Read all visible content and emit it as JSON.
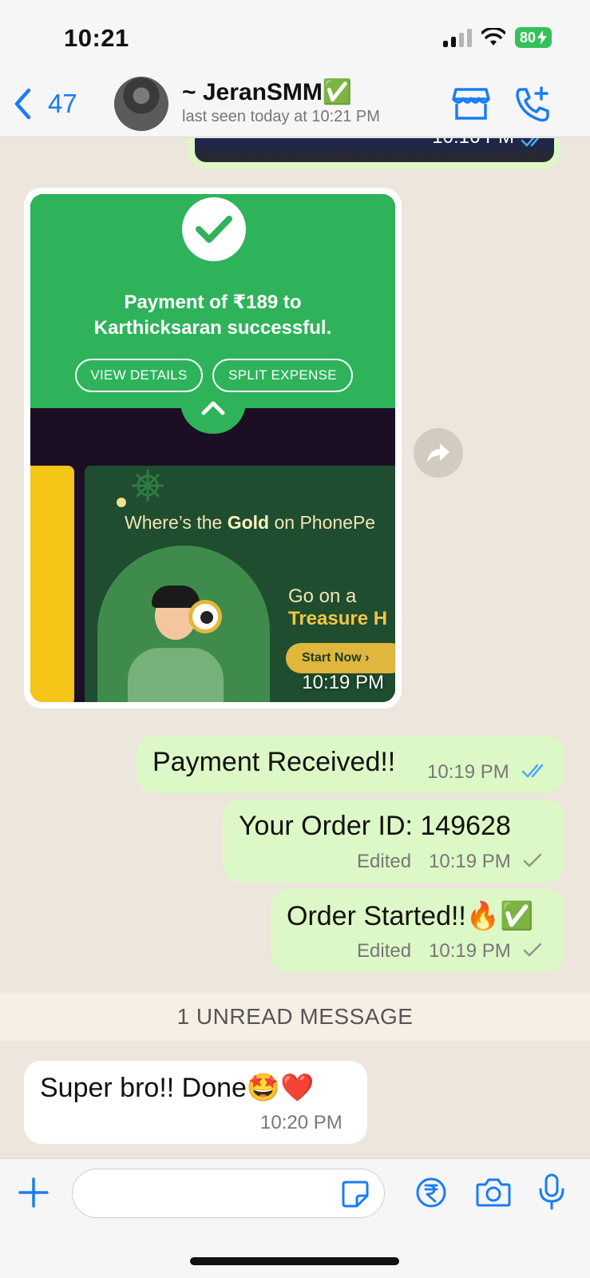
{
  "status_bar": {
    "time": "10:21",
    "battery": "80"
  },
  "header": {
    "back_count": "47",
    "contact_name": "~ JeranSMM✅",
    "contact_status": "last seen today at 10:21 PM"
  },
  "messages": {
    "top_image_time": "10:16 PM",
    "payment_image": {
      "title_line1": "Payment of ₹189 to",
      "title_line2": "Karthicksaran successful.",
      "btn_view_details": "VIEW DETAILS",
      "btn_split_expense": "SPLIT EXPENSE",
      "promo_title_prefix": "Where’s the ",
      "promo_title_bold": "Gold",
      "promo_title_suffix": " on PhonePe",
      "promo_go": "Go on a",
      "promo_treasure": "Treasure H",
      "promo_start": "Start Now ›",
      "time": "10:19 PM"
    },
    "payment_received": {
      "text": "Payment Received!!",
      "time": "10:19 PM"
    },
    "order_id": {
      "text": "Your Order ID: 149628",
      "edited": "Edited",
      "time": "10:19 PM"
    },
    "order_started": {
      "text": "Order Started!!🔥✅",
      "edited": "Edited",
      "time": "10:19 PM"
    },
    "unread_divider": "1 UNREAD MESSAGE",
    "incoming_reply": {
      "text": "Super bro!! Done🤩❤️",
      "time": "10:20 PM"
    }
  },
  "colors": {
    "accent": "#1a7cf5",
    "outgoing_bubble": "#dcf8c6",
    "incoming_bubble": "#ffffff",
    "read_tick": "#4fa9f0",
    "sent_tick": "#8a9a8a",
    "chat_background": "#ece6dc"
  },
  "icons": {
    "back": "chevron-left-icon",
    "store": "store-icon",
    "call": "phone-plus-icon",
    "attach": "plus-icon",
    "sticker": "sticker-icon",
    "rupee": "rupee-icon",
    "camera": "camera-icon",
    "mic": "microphone-icon"
  }
}
